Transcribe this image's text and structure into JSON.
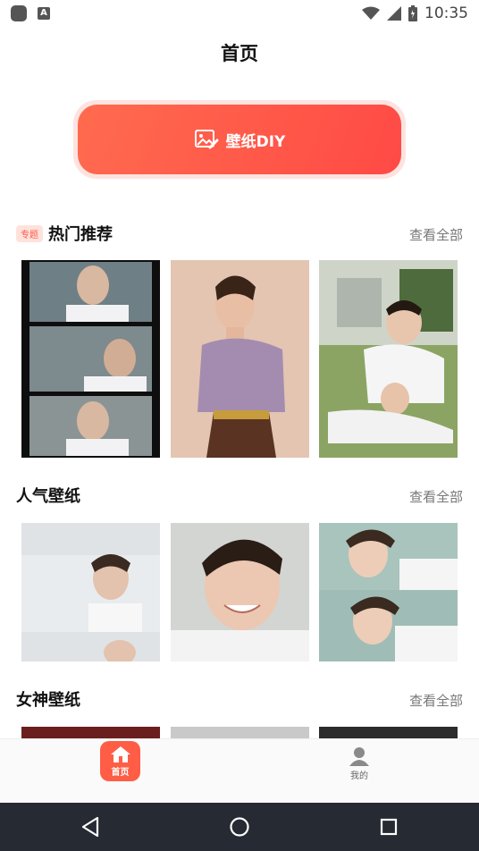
{
  "status_bar": {
    "time": "10:35",
    "notification_icon_letter": "A"
  },
  "header": {
    "title": "首页"
  },
  "diy": {
    "label": "壁纸DIY"
  },
  "sections": [
    {
      "badge": "专题",
      "title": "热门推荐",
      "see_all": "查看全部"
    },
    {
      "title": "人气壁纸",
      "see_all": "查看全部"
    },
    {
      "title": "女神壁纸",
      "see_all": "查看全部"
    }
  ],
  "bottom_nav": {
    "home_label": "首页",
    "mine_label": "我的"
  },
  "colors": {
    "accent": "#ff5d45",
    "accent_light": "#ffe2dc",
    "sys_nav": "#252a33"
  }
}
